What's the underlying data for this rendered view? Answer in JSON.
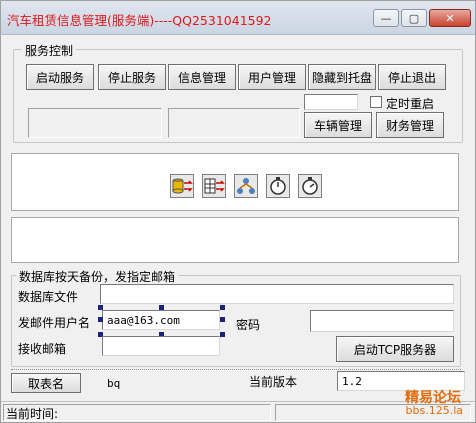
{
  "window": {
    "title": "汽车租赁信息管理(服务端)----QQ2531041592",
    "controls": {
      "minimize": "—",
      "maximize": "▢",
      "close": "✕"
    }
  },
  "service_group": {
    "label": "服务控制",
    "buttons": {
      "start": "启动服务",
      "stop": "停止服务",
      "info": "信息管理",
      "user": "用户管理",
      "hide": "隐藏到托盘",
      "exit": "停止退出",
      "vehicle": "车辆管理",
      "finance": "财务管理"
    },
    "time_input_value": "",
    "restart_checkbox_label": "定时重启",
    "restart_checked": false
  },
  "toolbar_icons": [
    "db-transfer-icon",
    "table-transfer-icon",
    "network-users-icon",
    "stopwatch-icon",
    "timer-icon"
  ],
  "backup_group": {
    "label": "数据库按天备份，发指定邮箱",
    "db_file_label": "数据库文件",
    "db_file_value": "",
    "sender_label": "发邮件用户名",
    "sender_value": "aaa@163.com",
    "password_label": "密码",
    "password_value": "",
    "receiver_label": "接收邮箱",
    "receiver_value": "",
    "tcp_button": "启动TCP服务器"
  },
  "bottom": {
    "table_name_button": "取表名",
    "table_name_value": "bq",
    "version_label": "当前版本",
    "version_value": "1.2"
  },
  "status": {
    "current_time_label": "当前时间:"
  },
  "watermark": {
    "line1": "精易论坛",
    "line2": "bbs.125.la"
  }
}
